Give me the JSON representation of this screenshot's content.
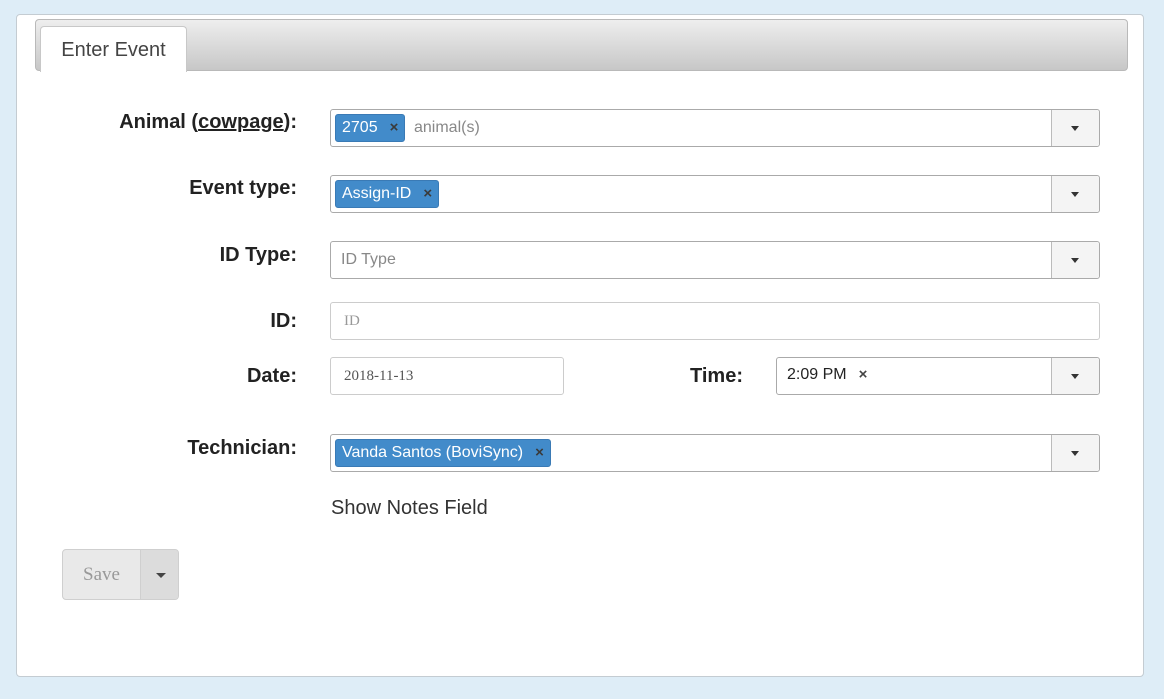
{
  "tab": {
    "label": "Enter Event"
  },
  "animal": {
    "label_prefix": "Animal (",
    "label_link": "cowpage",
    "label_suffix": "):",
    "chip": "2705",
    "placeholder": "animal(s)"
  },
  "event_type": {
    "label": "Event type:",
    "chip": "Assign-ID"
  },
  "id_type": {
    "label": "ID Type:",
    "placeholder": "ID Type"
  },
  "id": {
    "label": "ID:",
    "placeholder": "ID"
  },
  "date": {
    "label": "Date:",
    "value": "2018-11-13"
  },
  "time": {
    "label": "Time:",
    "value": "2:09 PM"
  },
  "technician": {
    "label": "Technician:",
    "chip": "Vanda Santos (BoviSync)"
  },
  "chip_remove": "×",
  "notes_link": "Show Notes Field",
  "save": {
    "label": "Save"
  }
}
